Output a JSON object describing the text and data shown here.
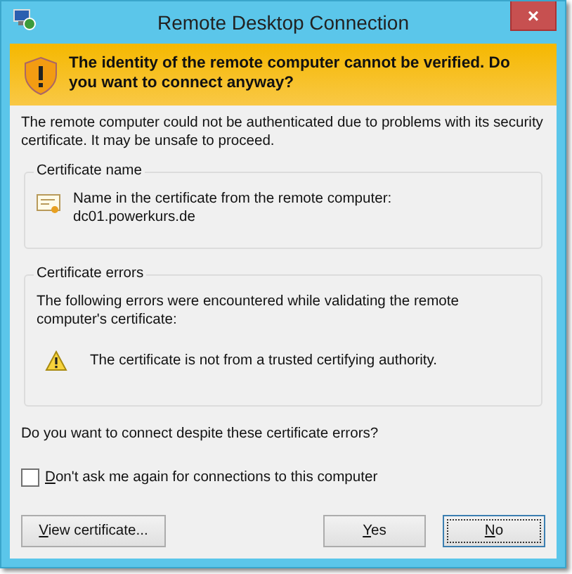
{
  "window": {
    "title": "Remote Desktop Connection",
    "close": "×"
  },
  "banner": {
    "text": "The identity of the remote computer cannot be verified. Do you want to connect anyway?"
  },
  "intro": "The remote computer could not be authenticated due to problems with its security certificate. It may be unsafe to proceed.",
  "certificate_name": {
    "legend": "Certificate name",
    "label": "Name in the certificate from the remote computer:",
    "value": "dc01.powerkurs.de"
  },
  "certificate_errors": {
    "legend": "Certificate errors",
    "intro": "The following errors were encountered while validating the remote computer's certificate:",
    "errors": [
      "The certificate is not from a trusted certifying authority."
    ]
  },
  "question": "Do you want to connect despite these certificate errors?",
  "dont_ask": {
    "label": "Don't ask me again for connections to this computer",
    "underline_first": true,
    "checked": false
  },
  "buttons": [
    {
      "label": "View certificate...",
      "underline_first": true,
      "default": false
    },
    {
      "label": "Yes",
      "underline_first": true,
      "default": false
    },
    {
      "label": "No",
      "underline_first": true,
      "default": true
    }
  ]
}
